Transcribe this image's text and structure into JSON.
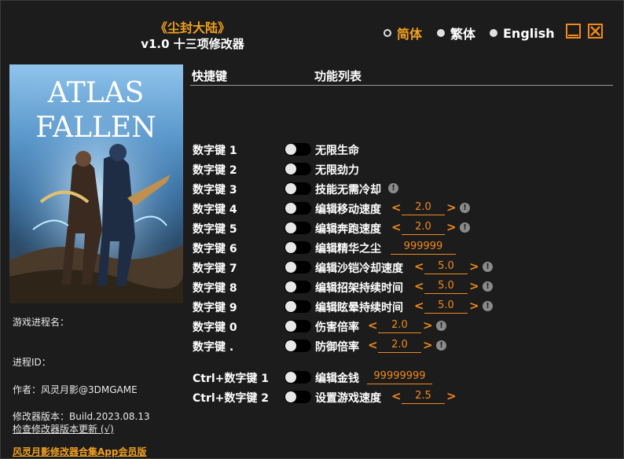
{
  "header": {
    "game_title": "《尘封大陆》",
    "subtitle": "v1.0 十三项修改器"
  },
  "languages": [
    {
      "label": "简体",
      "selected": true
    },
    {
      "label": "繁体",
      "selected": false
    },
    {
      "label": "English",
      "selected": false
    }
  ],
  "cover": {
    "title_line1": "ATLAS",
    "title_line2": "FALLEN"
  },
  "columns": {
    "hotkey": "快捷键",
    "function": "功能列表"
  },
  "rows": [
    {
      "hotkey": "数字键 1",
      "name": "无限生命"
    },
    {
      "hotkey": "数字键 2",
      "name": "无限劲力"
    },
    {
      "hotkey": "数字键 3",
      "name": "技能无需冷却",
      "info": true
    },
    {
      "hotkey": "数字键 4",
      "name": "编辑移动速度",
      "value": "2.0",
      "arrows": true,
      "info": true
    },
    {
      "hotkey": "数字键 5",
      "name": "编辑奔跑速度",
      "value": "2.0",
      "arrows": true,
      "info": true
    },
    {
      "hotkey": "数字键 6",
      "name": "编辑精华之尘",
      "value": "999999"
    },
    {
      "hotkey": "数字键 7",
      "name": "编辑沙铠冷却速度",
      "value": "5.0",
      "arrows": true,
      "info": true
    },
    {
      "hotkey": "数字键 8",
      "name": "编辑招架持续时间",
      "value": "5.0",
      "arrows": true,
      "info": true
    },
    {
      "hotkey": "数字键 9",
      "name": "编辑眩晕持续时间",
      "value": "5.0",
      "arrows": true,
      "info": true
    },
    {
      "hotkey": "数字键 0",
      "name": "伤害倍率",
      "value": "2.0",
      "arrows": true,
      "info": true
    },
    {
      "hotkey": "数字键 .",
      "name": "防御倍率",
      "value": "2.0",
      "arrows": true,
      "info": true
    },
    {
      "hotkey": "Ctrl+数字键 1",
      "name": "编辑金钱",
      "value": "99999999"
    },
    {
      "hotkey": "Ctrl+数字键 2",
      "name": "设置游戏速度",
      "value": "2.5",
      "arrows": true
    }
  ],
  "info": {
    "process_name": "游戏进程名：",
    "process_id": "进程ID：",
    "author": "作者：风灵月影@3DMGAME",
    "version": "修改器版本：Build.2023.08.13",
    "check_update": "检查修改器版本更新 (√)",
    "app_link": "风灵月影修改器合集App会员版"
  },
  "glyphs": {
    "left_arrow": "<",
    "right_arrow": ">",
    "info_mark": "!"
  },
  "colors": {
    "accent": "#f08a1c",
    "title": "#f0a020",
    "background": "#1c1c1c"
  }
}
